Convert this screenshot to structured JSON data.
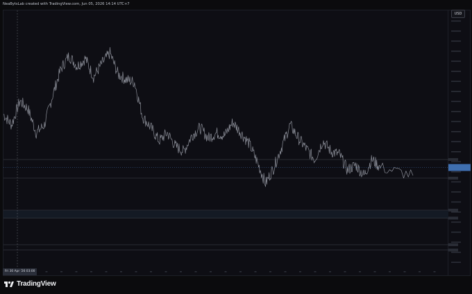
{
  "header": {
    "attribution": "NeaBytsLab created with TradingView.com, Jun 05, 2026 14:14 UTC+7"
  },
  "toolbar": {
    "currency_label": "USD"
  },
  "footer": {
    "brand": "TradingView",
    "time_badge": "Fri 30 Apr '26   03:00"
  },
  "colors": {
    "background": "#0b0b0d",
    "pane": "#0e0e14",
    "price_line": "#8d909a",
    "level_line": "#3a3d46",
    "zone_fill": "#141a24",
    "last_price_badge": "#3f6fb0"
  },
  "chart_data": {
    "type": "line",
    "title": "",
    "xlabel": "",
    "ylabel": "",
    "y_domain_pixels_note": "",
    "ylim": [
      0,
      100
    ],
    "x": [
      0,
      2,
      4,
      6,
      8,
      10,
      12,
      14,
      16,
      18,
      20,
      22,
      24,
      26,
      28,
      30,
      32,
      34,
      36,
      38,
      40,
      42,
      44,
      46,
      48,
      50,
      52,
      54,
      56,
      58,
      60,
      62,
      64,
      66,
      68,
      70,
      72,
      74,
      76,
      78,
      80,
      82,
      84,
      86,
      88,
      90,
      92,
      100
    ],
    "series": [
      {
        "values": [
          61,
          57,
          66,
          63,
          54,
          57,
          68,
          78,
          83,
          79,
          82,
          75,
          80,
          84,
          76,
          74,
          73,
          60,
          56,
          51,
          54,
          49,
          47,
          53,
          56,
          52,
          54,
          53,
          58,
          54,
          50,
          43,
          35,
          41,
          49,
          57,
          52,
          48,
          44,
          51,
          47,
          46,
          40,
          42,
          38,
          44,
          41,
          38
        ]
      }
    ],
    "levels": [
      {
        "name": "upper",
        "value": 44
      },
      {
        "name": "mid",
        "value": 37
      },
      {
        "name": "zone-top",
        "value": 25
      },
      {
        "name": "zone-bottom",
        "value": 22
      },
      {
        "name": "lower-1",
        "value": 12
      },
      {
        "name": "lower-2",
        "value": 10
      }
    ],
    "last_value": 41,
    "grid": false,
    "legend": "none"
  }
}
